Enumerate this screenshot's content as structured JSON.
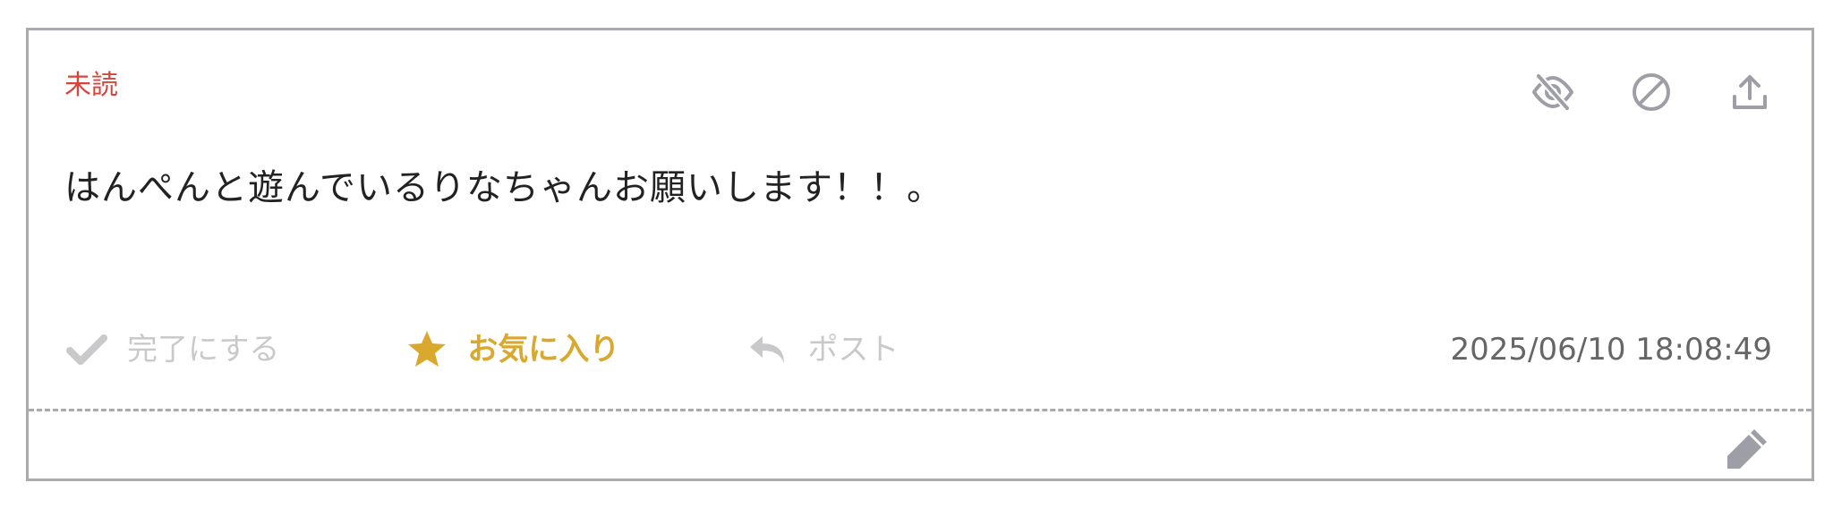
{
  "card": {
    "status_label": "未読",
    "message": "はんぺんと遊んでいるりなちゃんお願いします！！。",
    "timestamp": "2025/06/10 18:08:49",
    "top_icons": [
      "eye-slash-icon",
      "ban-icon",
      "share-upload-icon"
    ],
    "actions": {
      "done_label": "完了にする",
      "done_icon": "check-icon",
      "favorite_label": "お気に入り",
      "favorite_icon": "star-icon",
      "post_label": "ポスト",
      "post_icon": "reply-icon"
    },
    "edit_icon": "pencil-icon"
  },
  "colors": {
    "status_red": "#d9443a",
    "favorite_gold": "#d9a92f",
    "muted_gray": "#c9c9cc",
    "icon_gray": "#9e9ea6",
    "border_gray": "#a9a9b0",
    "text_dark": "#222222",
    "timestamp_gray": "#666666"
  }
}
